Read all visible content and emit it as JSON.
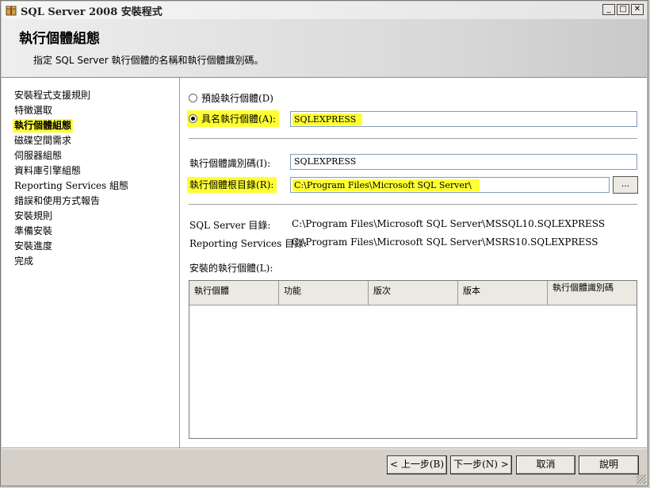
{
  "window": {
    "title": "SQL Server 2008 安裝程式",
    "minimize": "_",
    "maximize": "□",
    "close": "✕"
  },
  "header": {
    "title": "執行個體組態",
    "description": "指定 SQL Server 執行個體的名稱和執行個體識別碼。"
  },
  "nav": {
    "items": [
      "安裝程式支援規則",
      "特徵選取",
      "執行個體組態",
      "磁碟空間需求",
      "伺服器組態",
      "資料庫引擎組態",
      "Reporting Services 組態",
      "錯誤和使用方式報告",
      "安裝規則",
      "準備安裝",
      "安裝進度",
      "完成"
    ],
    "active_index": 2
  },
  "form": {
    "default_instance_label": "預設執行個體(D)",
    "named_instance_label": "具名執行個體(A):",
    "named_instance_value": "SQLEXPRESS",
    "instance_id_label": "執行個體識別碼(I):",
    "instance_id_value": "SQLEXPRESS",
    "root_dir_label": "執行個體根目錄(R):",
    "root_dir_value": "C:\\Program Files\\Microsoft SQL Server\\",
    "browse_label": "...",
    "sql_dir_label": "SQL Server 目錄:",
    "sql_dir_value": "C:\\Program Files\\Microsoft SQL Server\\MSSQL10.SQLEXPRESS",
    "rs_dir_label": "Reporting Services 目錄:",
    "rs_dir_value": "C:\\Program Files\\Microsoft SQL Server\\MSRS10.SQLEXPRESS",
    "installed_label": "安裝的執行個體(L):"
  },
  "table": {
    "columns": [
      "執行個體",
      "功能",
      "版次",
      "版本",
      "執行個體識別碼"
    ],
    "rows": []
  },
  "buttons": {
    "back": "< 上一步(B)",
    "next": "下一步(N) >",
    "cancel": "取消",
    "help": "說明"
  },
  "colors": {
    "highlight": "#ffff33"
  }
}
